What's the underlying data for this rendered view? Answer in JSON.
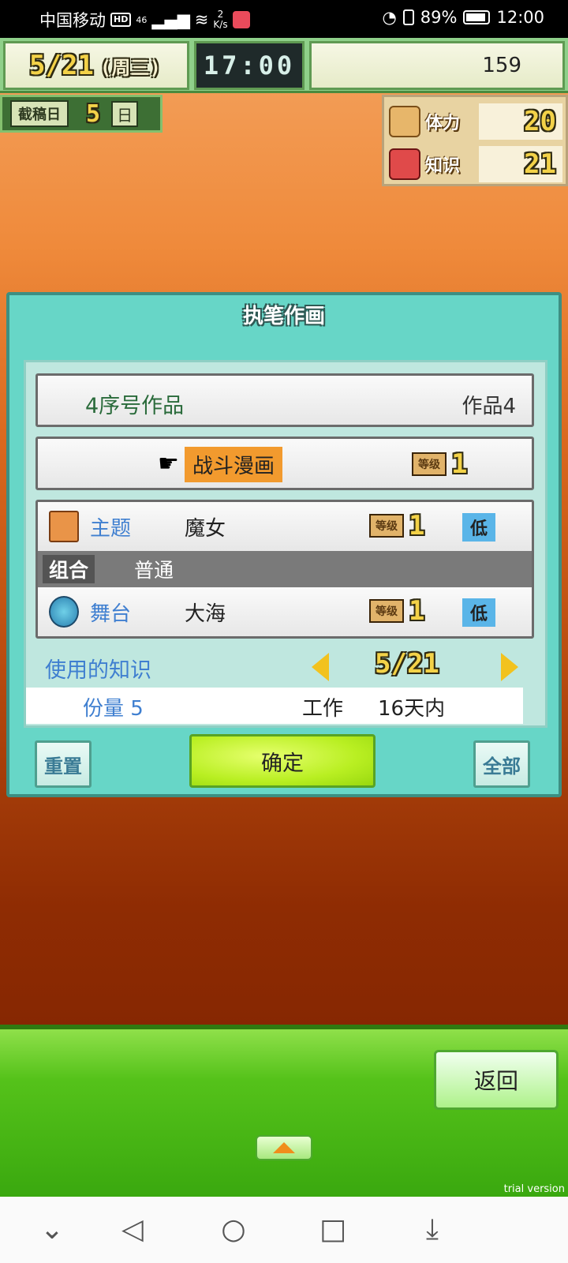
{
  "statusbar": {
    "carrier": "中国移动",
    "hd": "HD",
    "network": "46",
    "speed_num": "2",
    "speed_unit": "K/s",
    "battery": "89%",
    "time": "12:00"
  },
  "hud": {
    "date": "5/21",
    "weekday": "(周三)",
    "clock": "17:00",
    "money": "159",
    "deadline_label": "截稿日",
    "deadline_value": "5",
    "deadline_unit": "日",
    "stats": [
      {
        "label": "体力",
        "value": "20"
      },
      {
        "label": "知识",
        "value": "21"
      }
    ]
  },
  "dialog": {
    "title": "执笔作画",
    "serial_label": "4序号作品",
    "work_name": "作品4",
    "genre": "战斗漫画",
    "level_tag": "等级",
    "genre_level": "1",
    "theme_label": "主题",
    "theme_value": "魔女",
    "theme_level": "1",
    "theme_rating": "低",
    "combo_label": "组合",
    "combo_value": "普通",
    "stage_label": "舞台",
    "stage_value": "大海",
    "stage_level": "1",
    "stage_rating": "低",
    "knowledge_label": "使用的知识",
    "knowledge_count": "5/21",
    "amount_label": "份量 5",
    "work_label": "工作",
    "duration": "16天内",
    "reset_label": "重置",
    "confirm_label": "确定",
    "all_label": "全部"
  },
  "bottom": {
    "back_label": "返回",
    "trial": "trial version"
  },
  "colors": {
    "accent_green": "#98d80f",
    "dialog_teal": "#67d6c7",
    "genre_highlight": "#f29a2e"
  }
}
